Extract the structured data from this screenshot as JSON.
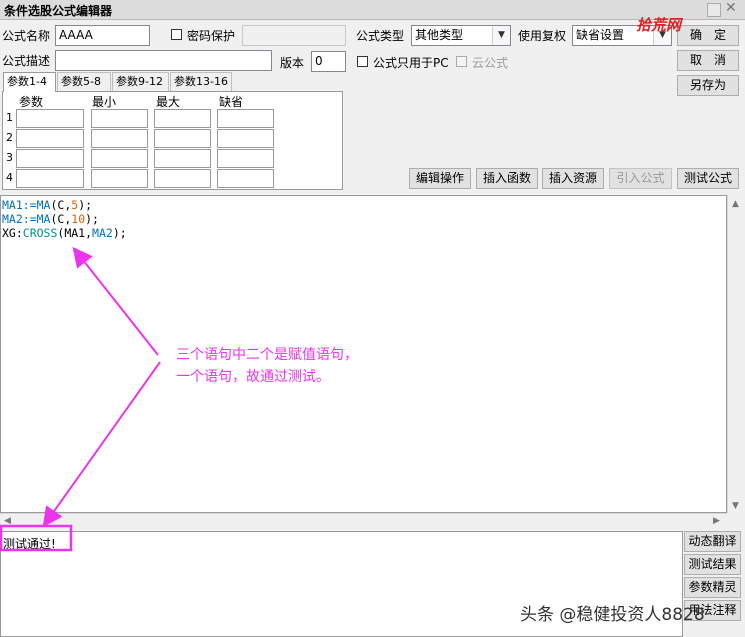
{
  "window": {
    "title": "条件选股公式编辑器"
  },
  "form": {
    "name_label": "公式名称",
    "name_value": "AAAA",
    "password_label": "密码保护",
    "type_label": "公式类型",
    "type_value": "其他类型",
    "restore_label": "使用复权",
    "restore_value": "缺省设置",
    "desc_label": "公式描述",
    "desc_value": "",
    "version_label": "版本",
    "version_value": "0",
    "pc_only_label": "公式只用于PC",
    "cloud_label": "云公式"
  },
  "buttons": {
    "ok": "确　定",
    "cancel": "取　消",
    "save_as": "另存为"
  },
  "tabs": [
    "参数1-4",
    "参数5-8",
    "参数9-12",
    "参数13-16"
  ],
  "params": {
    "headers": [
      "参数",
      "最小",
      "最大",
      "缺省"
    ],
    "rows": [
      "1",
      "2",
      "3",
      "4"
    ]
  },
  "editor_buttons": [
    "编辑操作",
    "插入函数",
    "插入资源",
    "引入公式",
    "测试公式"
  ],
  "code": {
    "l1": {
      "a": "MA1:=",
      "b": "MA",
      "c": "(C,",
      "d": "5",
      "e": ");"
    },
    "l2": {
      "a": "MA2:=",
      "b": "MA",
      "c": "(C,",
      "d": "10",
      "e": ");"
    },
    "l3": {
      "a": "XG:",
      "b": "CROSS",
      "c": "(MA1,",
      "d": "MA2",
      "e": ");"
    }
  },
  "result_text": "测试通过!",
  "side_buttons": [
    "动态翻译",
    "测试结果",
    "参数精灵",
    "用法注释"
  ],
  "annotation": {
    "line1": "三个语句中二个是赋值语句，",
    "line2": "一个语句，故通过测试。"
  },
  "watermark": {
    "top": "拾荒网",
    "bottom": "头条 @稳健投资人8828"
  },
  "colors": {
    "annotation": "#ee33ee",
    "code_var": "#0070c0",
    "code_num": "#e06000",
    "code_func": "#009090"
  }
}
